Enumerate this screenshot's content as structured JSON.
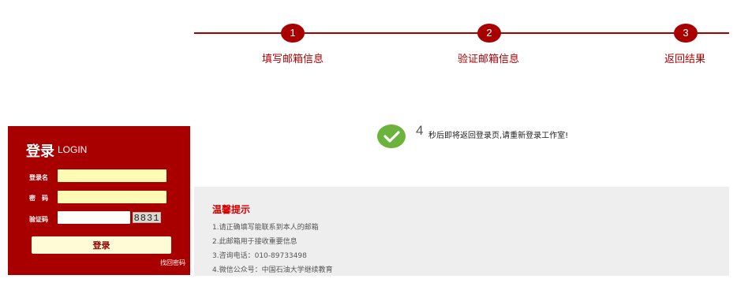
{
  "steps": [
    {
      "number": "1",
      "label": "填写邮箱信息"
    },
    {
      "number": "2",
      "label": "验证邮箱信息"
    },
    {
      "number": "3",
      "label": "返回结果"
    }
  ],
  "login": {
    "title": "登录",
    "subtitle": "LOGIN",
    "username_label": "登录名",
    "password_label": "密　码",
    "captcha_label": "验证码",
    "username_value": "",
    "password_value": "",
    "captcha_value": "",
    "captcha_image_text": "8831",
    "submit_label": "登录",
    "forgot_link": "找回密码"
  },
  "result": {
    "countdown": "4",
    "message": "秒后即将返回登录页,请重新登录工作室!",
    "icon": "checkmark-circle-icon",
    "icon_color": "#6cb33e"
  },
  "tips": {
    "title": "温馨提示",
    "items": [
      "1.请正确填写能联系到本人的邮箱",
      "2.此邮箱用于接收重要信息",
      "3.咨询电话：010-89733498",
      "4.微信公众号：中国石油大学继续教育"
    ]
  },
  "colors": {
    "brand_red": "#a80000",
    "input_yellow": "#fffbb5",
    "success_green": "#6cb33e",
    "tips_bg": "#eeeeee"
  }
}
